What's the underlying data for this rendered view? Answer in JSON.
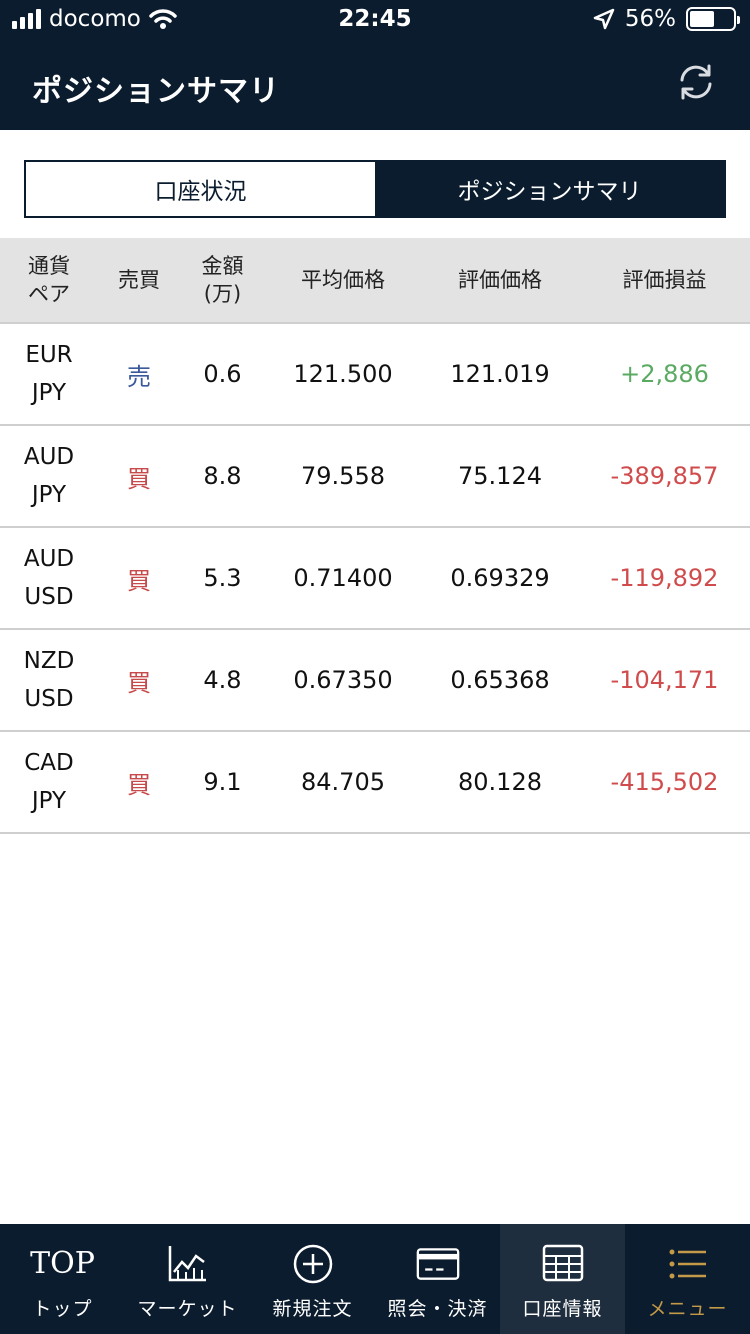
{
  "status_bar": {
    "carrier": "docomo",
    "time": "22:45",
    "battery_percent": "56%",
    "battery_level": 0.56,
    "icons": [
      "signal-icon",
      "wifi-icon",
      "location-icon",
      "battery-icon"
    ]
  },
  "header": {
    "title": "ポジションサマリ",
    "refresh_icon": "refresh-icon"
  },
  "segments": [
    {
      "label": "口座状況",
      "active": false
    },
    {
      "label": "ポジションサマリ",
      "active": true
    }
  ],
  "table": {
    "columns": [
      "通貨\nペア",
      "売買",
      "金額\n(万)",
      "平均価格",
      "評価価格",
      "評価損益"
    ],
    "rows": [
      {
        "pair": "EUR\nJPY",
        "side": "売",
        "side_type": "sell",
        "amount": "0.6",
        "avg_price": "121.500",
        "eval_price": "121.019",
        "pl": "+2,886",
        "pl_type": "pos"
      },
      {
        "pair": "AUD\nJPY",
        "side": "買",
        "side_type": "buy",
        "amount": "8.8",
        "avg_price": "79.558",
        "eval_price": "75.124",
        "pl": "-389,857",
        "pl_type": "neg"
      },
      {
        "pair": "AUD\nUSD",
        "side": "買",
        "side_type": "buy",
        "amount": "5.3",
        "avg_price": "0.71400",
        "eval_price": "0.69329",
        "pl": "-119,892",
        "pl_type": "neg"
      },
      {
        "pair": "NZD\nUSD",
        "side": "買",
        "side_type": "buy",
        "amount": "4.8",
        "avg_price": "0.67350",
        "eval_price": "0.65368",
        "pl": "-104,171",
        "pl_type": "neg"
      },
      {
        "pair": "CAD\nJPY",
        "side": "買",
        "side_type": "buy",
        "amount": "9.1",
        "avg_price": "84.705",
        "eval_price": "80.128",
        "pl": "-415,502",
        "pl_type": "neg"
      }
    ]
  },
  "tabbar": {
    "tabs": [
      {
        "label": "トップ",
        "icon_text": "TOP",
        "icon": "top-icon",
        "active": false
      },
      {
        "label": "マーケット",
        "icon": "chart-icon",
        "active": false
      },
      {
        "label": "新規注文",
        "icon": "plus-circle-icon",
        "active": false
      },
      {
        "label": "照会・決済",
        "icon": "card-icon",
        "active": false
      },
      {
        "label": "口座情報",
        "icon": "grid-icon",
        "active": true
      },
      {
        "label": "メニュー",
        "icon": "list-icon",
        "active": false
      }
    ]
  },
  "colors": {
    "navy": "#0b1c2e",
    "sell": "#3b5a9a",
    "buy": "#c64a4a",
    "profit": "#5aaa62",
    "loss": "#d04b4b",
    "menu_accent": "#c49a48"
  }
}
